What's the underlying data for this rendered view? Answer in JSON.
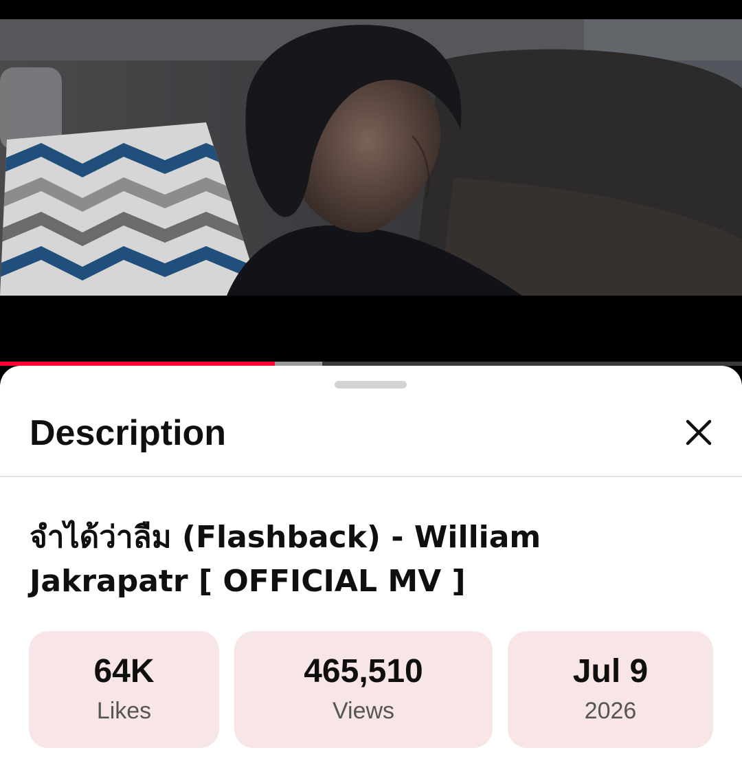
{
  "player": {
    "progress_played": 0.37,
    "progress_buffered": 0.434
  },
  "description_panel": {
    "title": "Description",
    "video_title": "จำได้ว่าลืม (Flashback) - William Jakrapatr [ OFFICIAL MV ]",
    "stats": [
      {
        "value": "64K",
        "label": "Likes"
      },
      {
        "value": "465,510",
        "label": "Views"
      },
      {
        "value": "Jul 9",
        "label": "2026"
      }
    ]
  },
  "colors": {
    "progress_played": "#ff0033",
    "stat_background": "#f8e5e6"
  },
  "icons": {
    "close": "close-icon"
  }
}
